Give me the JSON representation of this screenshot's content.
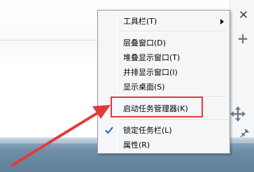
{
  "menu": {
    "items": [
      {
        "label": "工具栏(T)",
        "has_submenu": true
      },
      {
        "label": "层叠窗口(D)"
      },
      {
        "label": "堆叠显示窗口(T)"
      },
      {
        "label": "并排显示窗口(I)"
      },
      {
        "label": "显示桌面(S)"
      },
      {
        "label": "启动任务管理器(K)",
        "highlighted": true
      },
      {
        "label": "锁定任务栏(L)",
        "checked": true
      },
      {
        "label": "属性(R)"
      }
    ]
  },
  "icons": {
    "close": "close-icon",
    "add": "plus-icon",
    "move": "move-icon",
    "pin": "pin-icon",
    "check": "check-icon",
    "submenu": "chevron-right-icon"
  },
  "colors": {
    "highlight_box": "#e23a3a",
    "annotation_arrow": "#e23a3a",
    "taskbar": "#6f8fa9",
    "check": "#1f5fcf"
  },
  "symbols": {
    "close": "✕",
    "plus": "+"
  }
}
